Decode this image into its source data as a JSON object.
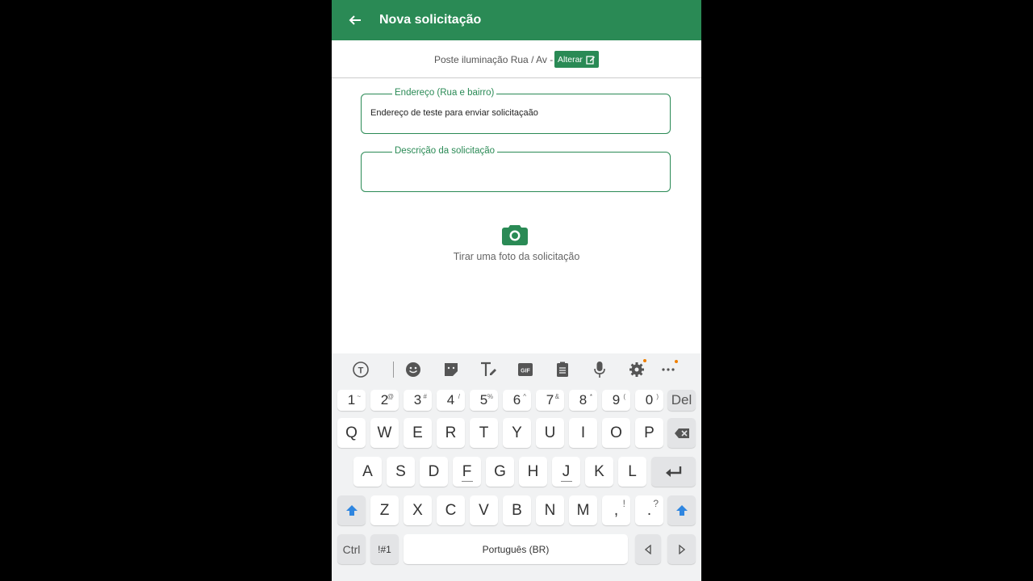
{
  "appbar": {
    "title": "Nova solicitação",
    "back_icon": "arrow-left-icon"
  },
  "category": {
    "text": "Poste iluminação Rua / Av -",
    "alter_label": "Alterar"
  },
  "address_field": {
    "label": "Endereço (Rua e bairro)",
    "value": "Endereço de teste para enviar solicitaçaão"
  },
  "description_field": {
    "label": "Descrição da solicitação",
    "value": ""
  },
  "photo": {
    "label": "Tirar uma foto da solicitação"
  },
  "colors": {
    "brand": "#2a8a55",
    "accent_blue": "#2f86e0"
  },
  "keyboard": {
    "numbers": [
      {
        "k": "1",
        "s": "~"
      },
      {
        "k": "2",
        "s": "@"
      },
      {
        "k": "3",
        "s": "#"
      },
      {
        "k": "4",
        "s": "/"
      },
      {
        "k": "5",
        "s": "%"
      },
      {
        "k": "6",
        "s": "^"
      },
      {
        "k": "7",
        "s": "&"
      },
      {
        "k": "8",
        "s": "*"
      },
      {
        "k": "9",
        "s": "("
      },
      {
        "k": "0",
        "s": ")"
      }
    ],
    "del_label": "Del",
    "row1": [
      "Q",
      "W",
      "E",
      "R",
      "T",
      "Y",
      "U",
      "I",
      "O",
      "P"
    ],
    "row2": [
      "A",
      "S",
      "D",
      "F",
      "G",
      "H",
      "J",
      "K",
      "L"
    ],
    "row3": [
      "Z",
      "X",
      "C",
      "V",
      "B",
      "N",
      "M"
    ],
    "comma": {
      "k": ",",
      "s": "!"
    },
    "period": {
      "k": ".",
      "s": "?"
    },
    "ctrl_label": "Ctrl",
    "sym_label": "!#1",
    "space_label": "Português (BR)"
  }
}
